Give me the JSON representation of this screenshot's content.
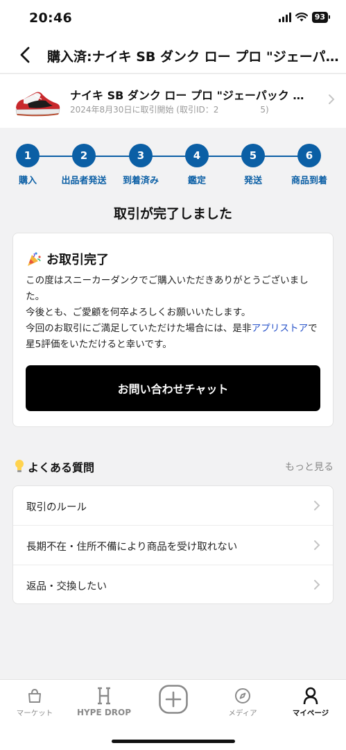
{
  "status": {
    "time": "20:46",
    "battery": "93"
  },
  "nav": {
    "title": "購入済:ナイキ SB ダンク ロー プロ \"ジェーパック シカゴ\""
  },
  "product": {
    "name": "ナイキ SB ダンク ロー プロ \"ジェーパック シカゴ\"",
    "meta": "2024年8月30日に取引開始 (取引ID：2　　　　　5)"
  },
  "steps": [
    {
      "num": "1",
      "label": "購入"
    },
    {
      "num": "2",
      "label": "出品者発送"
    },
    {
      "num": "3",
      "label": "到着済み"
    },
    {
      "num": "4",
      "label": "鑑定"
    },
    {
      "num": "5",
      "label": "発送"
    },
    {
      "num": "6",
      "label": "商品到着"
    }
  ],
  "status_title": "取引が完了しました",
  "card": {
    "title": "お取引完了",
    "line1": "この度はスニーカーダンクでご購入いただきありがとうございました。",
    "line2": "今後とも、ご愛顧を何卒よろしくお願いいたします。",
    "line3_pre": "今回のお取引にご満足していただけた場合には、是非",
    "line3_link": "アプリストア",
    "line3_post": "で星5評価をいただけると幸いです。",
    "button": "お問い合わせチャット"
  },
  "faq": {
    "title": "よくある質問",
    "more": "もっと見る",
    "items": [
      {
        "label": "取引のルール"
      },
      {
        "label": "長期不在・住所不備により商品を受け取れない"
      },
      {
        "label": "返品・交換したい"
      }
    ]
  },
  "tabs": [
    {
      "label": "マーケット",
      "icon": "bag-icon"
    },
    {
      "label": "HYPE DROP",
      "icon": "hype-h-icon"
    },
    {
      "label": "",
      "icon": "plus-icon"
    },
    {
      "label": "メディア",
      "icon": "compass-icon"
    },
    {
      "label": "マイページ",
      "icon": "person-icon"
    }
  ],
  "colors": {
    "accent": "#0b5fa5",
    "link": "#2853c9",
    "button": "#000000"
  }
}
